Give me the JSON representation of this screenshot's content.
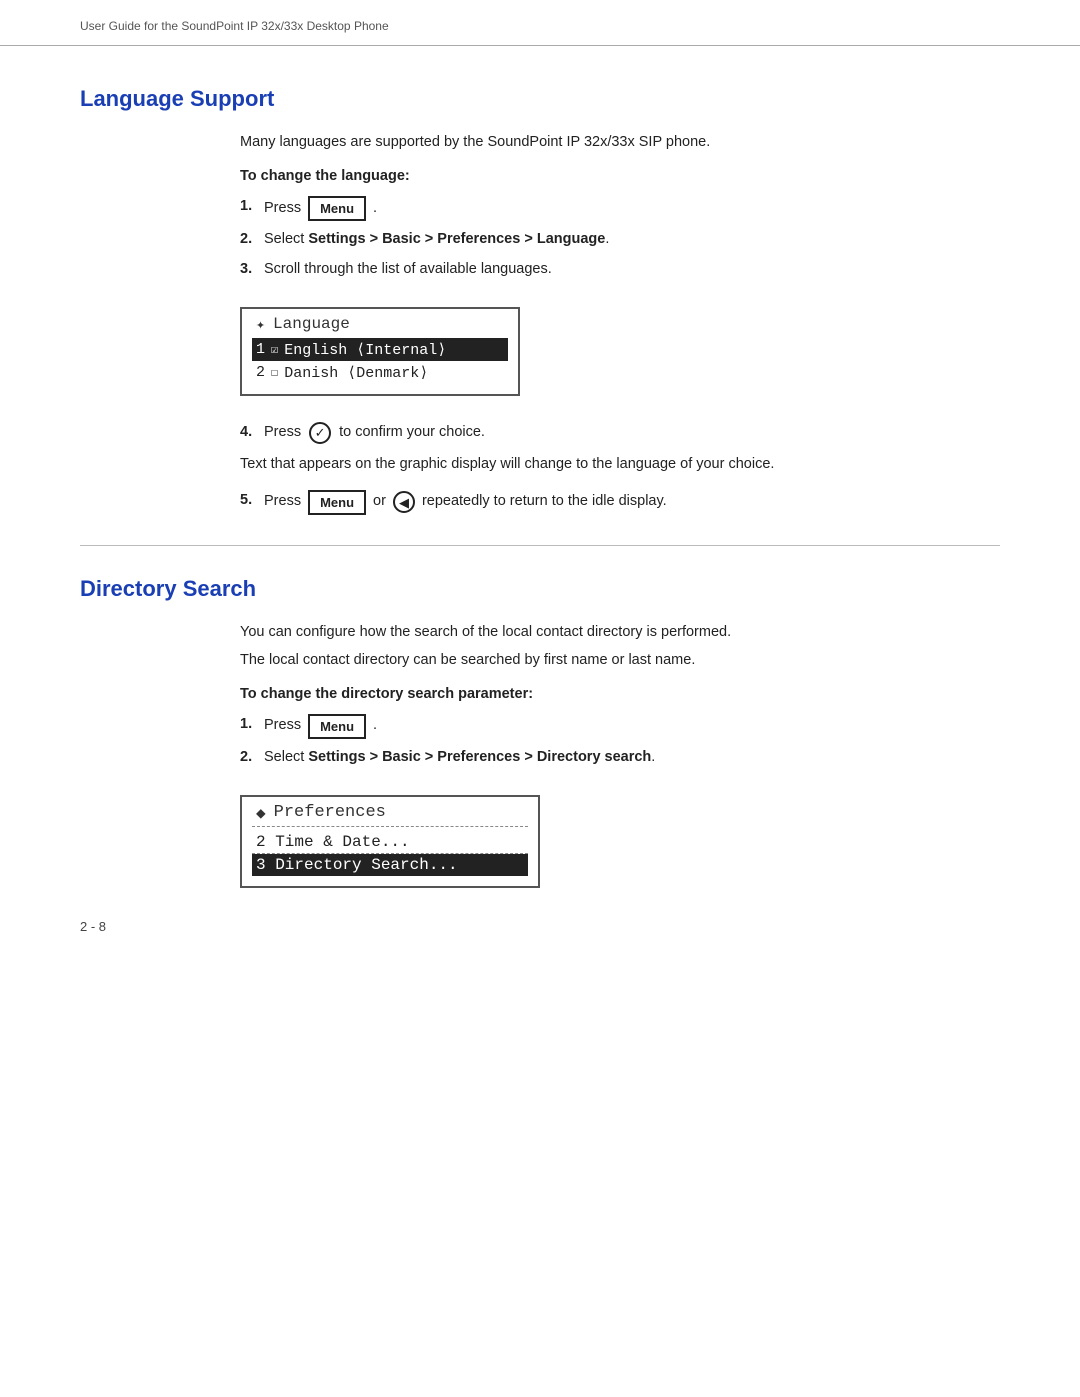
{
  "header": {
    "text": "User Guide for the SoundPoint IP 32x/33x Desktop Phone"
  },
  "section1": {
    "heading": "Language Support",
    "intro": "Many languages are supported by the SoundPoint IP 32x/33x SIP phone.",
    "subheading": "To change the language:",
    "steps": [
      {
        "num": "1.",
        "prefix": "Press",
        "button": "Menu",
        "suffix": "."
      },
      {
        "num": "2.",
        "text": "Select Settings > Basic > Preferences > Language."
      },
      {
        "num": "3.",
        "text": "Scroll through the list of available languages."
      },
      {
        "num": "4.",
        "prefix": "Press",
        "icon": "check",
        "suffix": "to confirm your choice."
      },
      {
        "num": "5.",
        "prefix": "Press",
        "button": "Menu",
        "middle": "or",
        "icon": "left-arrow",
        "suffix": "repeatedly to return to the idle display."
      }
    ],
    "after_step4_text": "Text that appears on the graphic display will change to the language of your choice.",
    "screen": {
      "title_icon": "✦",
      "title_text": "Language",
      "rows": [
        {
          "selected": true,
          "icon": "checked",
          "text": "English (Internal)"
        },
        {
          "selected": false,
          "icon": "unchecked",
          "text": "Danish (Denmark)"
        }
      ],
      "row_prefix": [
        "1 ",
        "2 "
      ]
    }
  },
  "section2": {
    "heading": "Directory Search",
    "intro1": "You can configure how the search of the local contact directory is performed.",
    "intro2": "The local contact directory can be searched by first name or last name.",
    "subheading": "To change the directory search parameter:",
    "steps": [
      {
        "num": "1.",
        "prefix": "Press",
        "button": "Menu",
        "suffix": "."
      },
      {
        "num": "2.",
        "text": "Select Settings > Basic > Preferences > Directory search."
      }
    ],
    "screen": {
      "title_icon": "✦",
      "title_text": "Preferences",
      "rows": [
        {
          "selected": false,
          "text": "2 Time & Date..."
        },
        {
          "selected": true,
          "text": "3 Directory Search..."
        }
      ]
    }
  },
  "footer": {
    "page": "2 - 8"
  },
  "labels": {
    "menu_btn": "Menu",
    "step2_bold_lang": "Settings > Basic > Preferences > Language",
    "step2_bold_dir": "Settings > Basic > Preferences > Directory search"
  }
}
